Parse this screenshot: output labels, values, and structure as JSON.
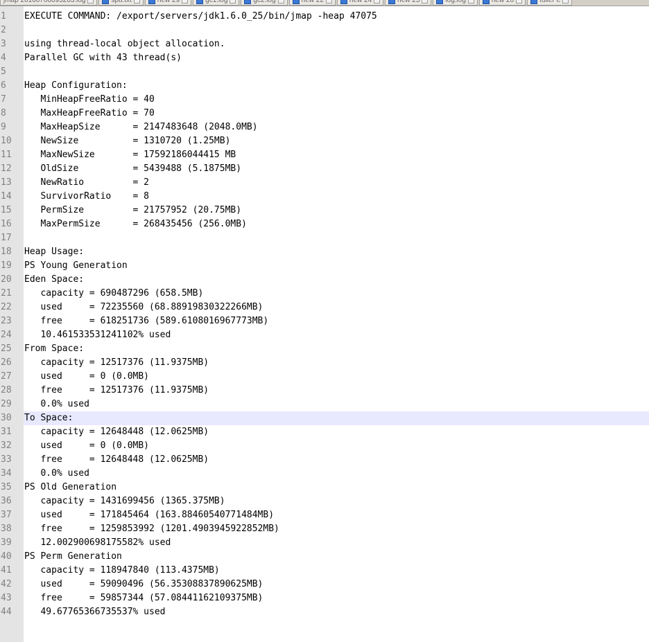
{
  "tabs": [
    {
      "label": "jmap 20160706095203.log"
    },
    {
      "label": "spu.txt"
    },
    {
      "label": "new 29"
    },
    {
      "label": "gc1.log"
    },
    {
      "label": "gc2.log"
    },
    {
      "label": "new 22"
    },
    {
      "label": "new 24"
    },
    {
      "label": "new 25"
    },
    {
      "label": "log.log"
    },
    {
      "label": "new 26"
    },
    {
      "label": "fuller e"
    }
  ],
  "current_line": 30,
  "lines": [
    {
      "n": "1",
      "text": "EXECUTE COMMAND: /export/servers/jdk1.6.0_25/bin/jmap -heap 47075"
    },
    {
      "n": "2",
      "text": ""
    },
    {
      "n": "3",
      "text": "using thread-local object allocation."
    },
    {
      "n": "4",
      "text": "Parallel GC with 43 thread(s)"
    },
    {
      "n": "5",
      "text": ""
    },
    {
      "n": "6",
      "text": "Heap Configuration:"
    },
    {
      "n": "7",
      "text": "   MinHeapFreeRatio = 40"
    },
    {
      "n": "8",
      "text": "   MaxHeapFreeRatio = 70"
    },
    {
      "n": "9",
      "text": "   MaxHeapSize      = 2147483648 (2048.0MB)"
    },
    {
      "n": "10",
      "text": "   NewSize          = 1310720 (1.25MB)"
    },
    {
      "n": "11",
      "text": "   MaxNewSize       = 17592186044415 MB"
    },
    {
      "n": "12",
      "text": "   OldSize          = 5439488 (5.1875MB)"
    },
    {
      "n": "13",
      "text": "   NewRatio         = 2"
    },
    {
      "n": "14",
      "text": "   SurvivorRatio    = 8"
    },
    {
      "n": "15",
      "text": "   PermSize         = 21757952 (20.75MB)"
    },
    {
      "n": "16",
      "text": "   MaxPermSize      = 268435456 (256.0MB)"
    },
    {
      "n": "17",
      "text": ""
    },
    {
      "n": "18",
      "text": "Heap Usage:"
    },
    {
      "n": "19",
      "text": "PS Young Generation"
    },
    {
      "n": "20",
      "text": "Eden Space:"
    },
    {
      "n": "21",
      "text": "   capacity = 690487296 (658.5MB)"
    },
    {
      "n": "22",
      "text": "   used     = 72235560 (68.88919830322266MB)"
    },
    {
      "n": "23",
      "text": "   free     = 618251736 (589.6108016967773MB)"
    },
    {
      "n": "24",
      "text": "   10.461533531241102% used"
    },
    {
      "n": "25",
      "text": "From Space:"
    },
    {
      "n": "26",
      "text": "   capacity = 12517376 (11.9375MB)"
    },
    {
      "n": "27",
      "text": "   used     = 0 (0.0MB)"
    },
    {
      "n": "28",
      "text": "   free     = 12517376 (11.9375MB)"
    },
    {
      "n": "29",
      "text": "   0.0% used"
    },
    {
      "n": "30",
      "text": "To Space:"
    },
    {
      "n": "31",
      "text": "   capacity = 12648448 (12.0625MB)"
    },
    {
      "n": "32",
      "text": "   used     = 0 (0.0MB)"
    },
    {
      "n": "33",
      "text": "   free     = 12648448 (12.0625MB)"
    },
    {
      "n": "34",
      "text": "   0.0% used"
    },
    {
      "n": "35",
      "text": "PS Old Generation"
    },
    {
      "n": "36",
      "text": "   capacity = 1431699456 (1365.375MB)"
    },
    {
      "n": "37",
      "text": "   used     = 171845464 (163.88460540771484MB)"
    },
    {
      "n": "38",
      "text": "   free     = 1259853992 (1201.4903945922852MB)"
    },
    {
      "n": "39",
      "text": "   12.002900698175582% used"
    },
    {
      "n": "40",
      "text": "PS Perm Generation"
    },
    {
      "n": "41",
      "text": "   capacity = 118947840 (113.4375MB)"
    },
    {
      "n": "42",
      "text": "   used     = 59090496 (56.35308837890625MB)"
    },
    {
      "n": "43",
      "text": "   free     = 59857344 (57.08441162109375MB)"
    },
    {
      "n": "44",
      "text": "   49.67765366735537% used"
    }
  ]
}
